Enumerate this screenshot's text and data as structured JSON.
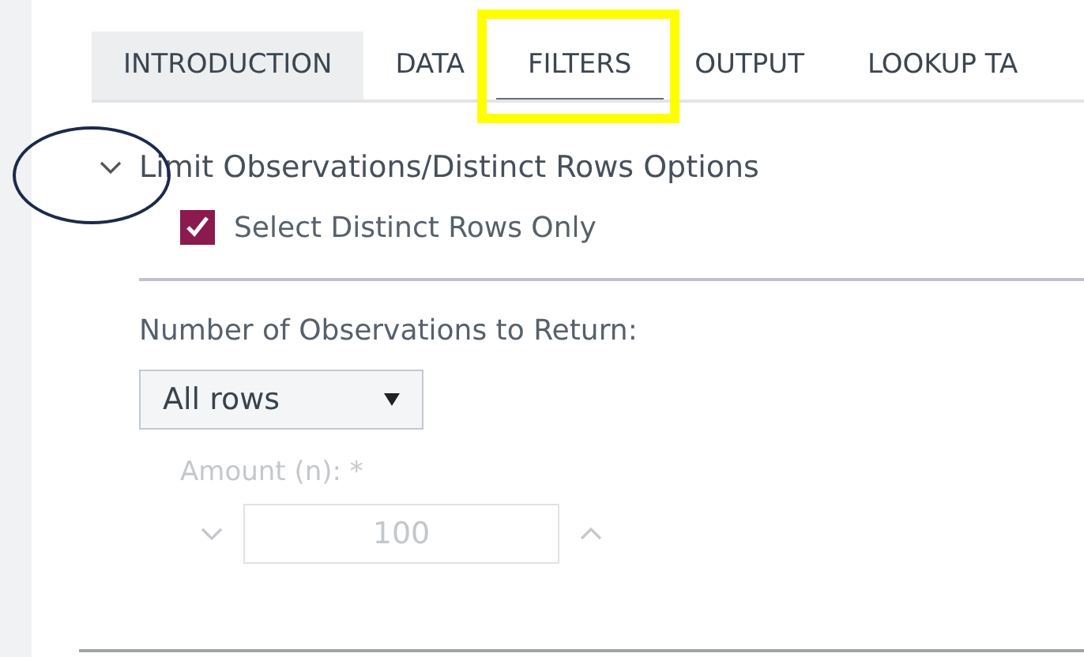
{
  "tabs": [
    {
      "label": "INTRODUCTION",
      "selected": false,
      "hovered": true
    },
    {
      "label": "DATA",
      "selected": false,
      "hovered": false
    },
    {
      "label": "FILTERS",
      "selected": true,
      "hovered": false
    },
    {
      "label": "OUTPUT",
      "selected": false,
      "hovered": false
    },
    {
      "label": "LOOKUP TA",
      "selected": false,
      "hovered": false
    }
  ],
  "section": {
    "title": "Limit Observations/Distinct Rows Options",
    "expanded": true
  },
  "distinct_rows": {
    "label": "Select Distinct Rows Only",
    "checked": true
  },
  "observations": {
    "label": "Number of Observations to Return:",
    "value": "All rows"
  },
  "amount": {
    "label": "Amount (n): *",
    "value": "100",
    "disabled": true
  }
}
